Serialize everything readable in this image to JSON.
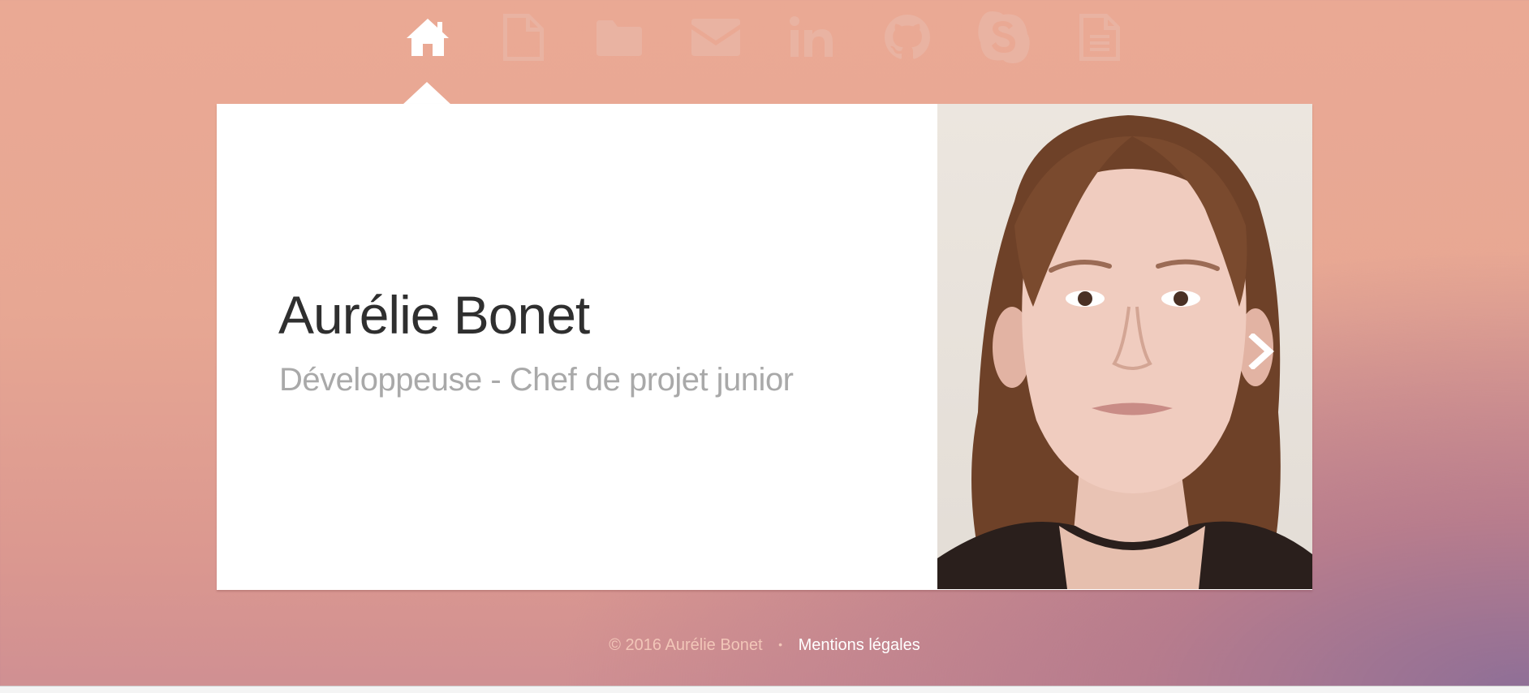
{
  "nav": {
    "items": [
      {
        "icon": "home-icon",
        "active": true
      },
      {
        "icon": "document-icon",
        "active": false
      },
      {
        "icon": "folder-icon",
        "active": false
      },
      {
        "icon": "envelope-icon",
        "active": false
      },
      {
        "icon": "linkedin-icon",
        "active": false
      },
      {
        "icon": "github-icon",
        "active": false
      },
      {
        "icon": "skype-icon",
        "active": false
      },
      {
        "icon": "file-text-icon",
        "active": false
      }
    ]
  },
  "profile": {
    "name": "Aurélie Bonet",
    "role": "Développeuse - Chef de projet junior"
  },
  "portrait": {
    "next_icon": "chevron-right-icon"
  },
  "footer": {
    "copyright": "© 2016 Aurélie Bonet",
    "separator": "•",
    "legal_link": "Mentions légales"
  },
  "colors": {
    "background_top": "#eaa994",
    "background_corner": "#8e6f97",
    "icon_faded": "#e9b3a2",
    "icon_active": "#ffffff",
    "name_text": "#2f2f2f",
    "role_text": "#a9a9a9"
  }
}
